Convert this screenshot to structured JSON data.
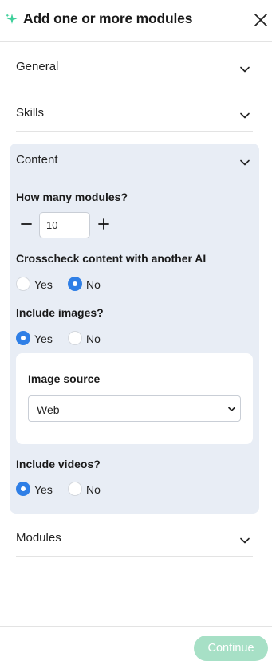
{
  "header": {
    "title": "Add one or more modules",
    "icon": "sparkle-icon",
    "close_icon": "close-icon"
  },
  "sections": {
    "general": {
      "label": "General",
      "expanded": false
    },
    "skills": {
      "label": "Skills",
      "expanded": false
    },
    "content": {
      "label": "Content",
      "expanded": true
    },
    "modules": {
      "label": "Modules",
      "expanded": false
    }
  },
  "content": {
    "modules_count": {
      "label": "How many modules?",
      "value": "10"
    },
    "crosscheck": {
      "label": "Crosscheck content with another AI",
      "yes": "Yes",
      "no": "No",
      "selected": "No"
    },
    "images": {
      "label": "Include images?",
      "yes": "Yes",
      "no": "No",
      "selected": "Yes"
    },
    "image_source": {
      "label": "Image source",
      "value": "Web"
    },
    "videos": {
      "label": "Include videos?",
      "yes": "Yes",
      "no": "No",
      "selected": "Yes"
    }
  },
  "footer": {
    "continue_label": "Continue"
  },
  "colors": {
    "accent_blue": "#2f7fe6",
    "panel_bg": "#e8edf5",
    "continue_bg": "#a7e0c6",
    "sparkle": "#3ecf9a"
  }
}
